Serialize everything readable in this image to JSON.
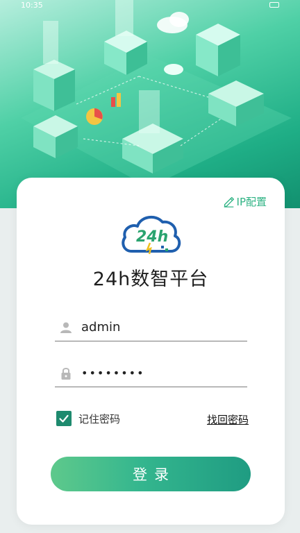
{
  "status_bar": {
    "left_text": "10:35"
  },
  "header": {
    "ip_config_label": "IP配置"
  },
  "app": {
    "title": "24h数智平台",
    "logo_text": "24h"
  },
  "login": {
    "username_value": "admin",
    "password_value": "••••••••",
    "remember_label": "记住密码",
    "remember_checked": true,
    "forgot_label": "找回密码",
    "submit_label": "登录"
  },
  "colors": {
    "brand_green": "#2fb384",
    "checkbox_green": "#1e8a6e",
    "logo_blue": "#1f5fae"
  },
  "icons": {
    "ip_config": "pencil-icon",
    "username": "user-icon",
    "password": "lock-icon",
    "checkbox": "check-icon"
  }
}
